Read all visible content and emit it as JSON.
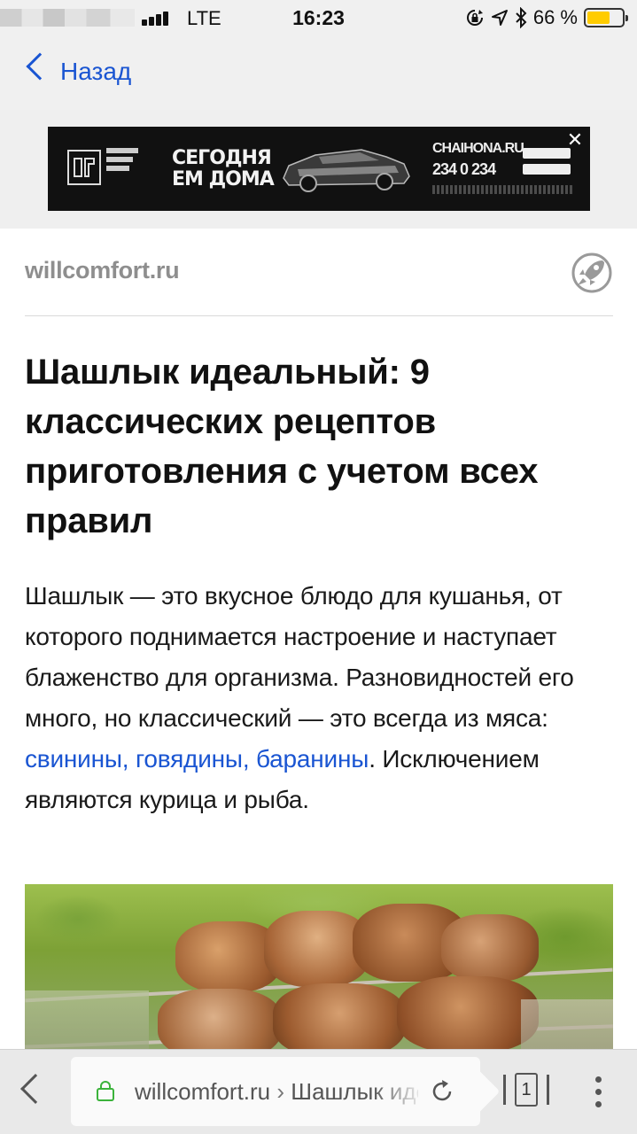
{
  "status_bar": {
    "network": "LTE",
    "time": "16:23",
    "battery_percent": "66 %",
    "battery_level": 0.66,
    "icons": [
      "signal-icon",
      "lock-rotation-icon",
      "location-icon",
      "bluetooth-icon",
      "battery-icon"
    ]
  },
  "nav": {
    "back_label": "Назад"
  },
  "ad": {
    "headline_line1": "СЕГОДНЯ",
    "headline_line2": "ЕМ ДОМА",
    "brand": "CHAIHONA.RU",
    "phone": "234 0 234",
    "close": "✕"
  },
  "article": {
    "source": "willcomfort.ru",
    "title": "Шашлык идеальный: 9 классических рецептов приготовления с учетом всех правил",
    "intro_before_link": "Шашлык — это вкусное блюдо для кушанья, от которого поднимается настроение и наступает блаженство для организма. Разновидностей его много, но классический — это всегда из мяса: ",
    "intro_link": "свинины, говядины, баранины",
    "intro_after_link": ". Исключением являются курица и рыба."
  },
  "browser": {
    "url_domain": "willcomfort.ru",
    "url_separator": " › ",
    "url_title": "Шашлык идеальный",
    "tabs_count": "1"
  },
  "colors": {
    "link": "#1a55d2",
    "battery": "#ffcc00",
    "lock": "#3bb33b"
  }
}
